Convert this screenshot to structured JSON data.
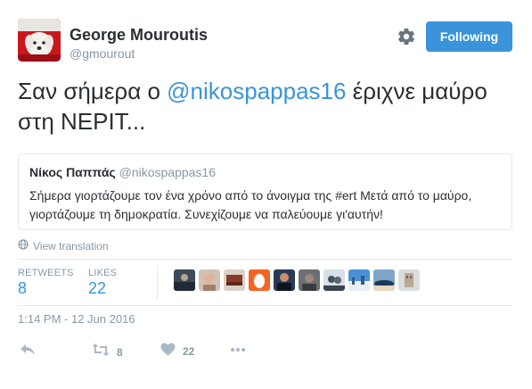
{
  "author": {
    "name": "George Mouroutis",
    "handle": "@gmourout"
  },
  "follow_button": {
    "label": "Following"
  },
  "tweet": {
    "text_part1": "Σαν σήμερα ο ",
    "mention": "@nikospappas16",
    "text_part2": " έριχνε μαύρο στη ΝΕΡΙΤ..."
  },
  "quoted_tweet": {
    "name": "Νίκος Παππάς",
    "handle": "@nikospappas16",
    "text": "Σήμερα γιορτάζουμε τον ένα χρόνο από το άνοιγμα της #ert Μετά από το μαύρο, γιορτάζουμε τη δημοκρατία. Συνεχίζουμε να παλεύουμε γι'αυτήν!"
  },
  "view_translation": "View translation",
  "stats": {
    "retweets_label": "RETWEETS",
    "retweets_value": "8",
    "likes_label": "LIKES",
    "likes_value": "22"
  },
  "timestamp": "1:14 PM - 12 Jun 2016",
  "actions": {
    "retweet_count": "8",
    "like_count": "22"
  },
  "colors": {
    "accent": "#3b94d9",
    "muted": "#8899a6",
    "text": "#292f33",
    "border": "#e1e8ed"
  }
}
